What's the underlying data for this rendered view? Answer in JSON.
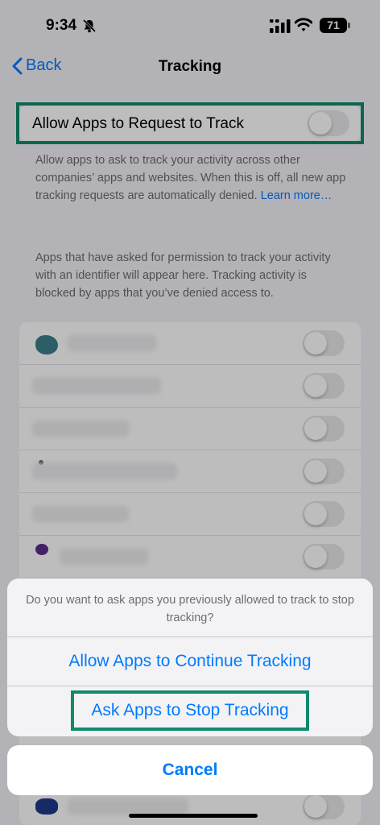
{
  "status_bar": {
    "time": "9:34",
    "battery": "71",
    "icons": [
      "bell-slash-icon",
      "cellular-signal-icon",
      "wifi-icon",
      "battery-icon"
    ]
  },
  "nav": {
    "back_label": "Back",
    "title": "Tracking"
  },
  "tracking": {
    "toggle_label": "Allow Apps to Request to Track",
    "enabled": false,
    "description": "Allow apps to ask to track your activity across other companies’ apps and websites. When this is off, all new app tracking requests are automatically denied. ",
    "learn_more": "Learn more…",
    "apps_note": "Apps that have asked for permission to track your activity with an identifier will appear here. Tracking activity is blocked by apps that you’ve denied access to."
  },
  "apps": [
    {
      "enabled": false
    },
    {
      "enabled": false
    },
    {
      "enabled": false
    },
    {
      "enabled": false
    },
    {
      "enabled": false
    },
    {
      "enabled": false
    }
  ],
  "action_sheet": {
    "message": "Do you want to ask apps you previously allowed to track to stop tracking?",
    "continue_label": "Allow Apps to Continue Tracking",
    "stop_label": "Ask Apps to Stop Tracking",
    "cancel_label": "Cancel"
  },
  "colors": {
    "accent": "#007aff",
    "highlight": "#0f8a6c"
  }
}
